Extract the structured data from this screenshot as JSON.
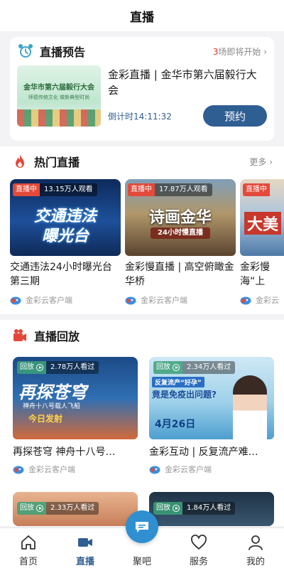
{
  "header": {
    "title": "直播"
  },
  "preview": {
    "section_title": "直播预告",
    "upcoming_count": "3",
    "upcoming_suffix": "场即将开始 ›",
    "thumb_title": "金华市第六届毅行大会",
    "thumb_sub": "师德传统文化 做新典型时尚",
    "event_title": "金彩直播 | 金华市第六届毅行大会",
    "countdown": "倒计时14:11:32",
    "button_label": "预约"
  },
  "hot": {
    "section_title": "热门直播",
    "more_label": "更多 ›",
    "cards": [
      {
        "badge": "直播中",
        "views": "13.15万人观看",
        "thumb_text_1": "交通违法",
        "thumb_text_2": "曝光台",
        "title": "交通违法24小时曝光台第三期",
        "source": "金彩云客户端"
      },
      {
        "badge": "直播中",
        "views": "17.87万人观看",
        "thumb_text_1": "诗画金华",
        "thumb_text_2": "24小时慢直播",
        "title": "金彩慢直播 | 高空俯瞰金华桥",
        "source": "金彩云客户端"
      },
      {
        "badge": "直播中",
        "views": "",
        "thumb_text_1": "大美",
        "thumb_text_2": "",
        "title": "金彩慢海“上",
        "source": "金彩云"
      }
    ]
  },
  "replay": {
    "section_title": "直播回放",
    "cards": [
      {
        "badge": "回放",
        "views": "2.78万人看过",
        "thumb_text_1": "再探苍穹",
        "thumb_text_2": "神舟十八号载人飞船",
        "thumb_text_3": "今日发射",
        "title": "再探苍穹 神舟十八号…",
        "source": "金彩云客户端"
      },
      {
        "badge": "回放",
        "views": "2.34万人看过",
        "thumb_text_1": "反复流产“好孕”",
        "thumb_text_2": "竟是免疫出问题?",
        "thumb_text_3": "4月26日",
        "title": "金彩互动 | 反复流产难…",
        "source": "金彩云客户端"
      },
      {
        "badge": "回放",
        "views": "2.33万人看过"
      },
      {
        "badge": "回放",
        "views": "1.84万人看过"
      }
    ]
  },
  "tabbar": {
    "tabs": [
      {
        "label": "首页",
        "icon": "home-icon"
      },
      {
        "label": "直播",
        "icon": "live-video-icon"
      },
      {
        "label": "聚吧",
        "icon": "chat-bubble-icon"
      },
      {
        "label": "服务",
        "icon": "heart-icon"
      },
      {
        "label": "我的",
        "icon": "user-icon"
      }
    ],
    "active": "直播"
  },
  "colors": {
    "accent": "#2f5e93",
    "live_red": "#e34a3b",
    "fab_blue": "#2f8fd1"
  }
}
